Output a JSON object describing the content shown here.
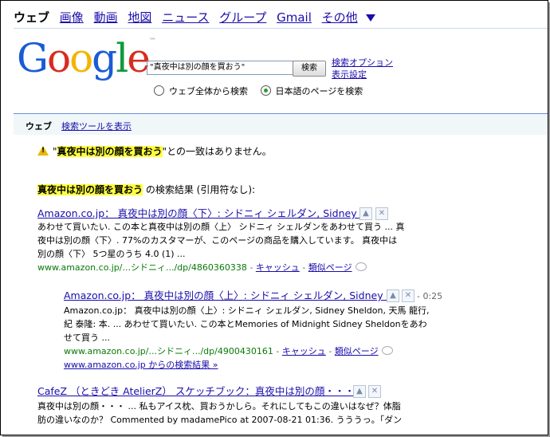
{
  "topnav": {
    "current": "ウェブ",
    "links": [
      "画像",
      "動画",
      "地図",
      "ニュース",
      "グループ",
      "Gmail",
      "その他"
    ]
  },
  "logo": {
    "text": "Google",
    "tm": "™"
  },
  "search": {
    "query": "\"真夜中は別の顔を買おう\"",
    "button": "検索",
    "advanced": "検索オプション",
    "prefs": "表示設定",
    "radio_all": "ウェブ全体から検索",
    "radio_jp": "日本語のページを検索"
  },
  "bar": {
    "web": "ウェブ",
    "tools": "検索ツールを表示"
  },
  "notice": {
    "quote_open": "\"",
    "query": "真夜中は別の顔を買おう",
    "quote_close": "\"",
    "rest": "との一致はありません。"
  },
  "results_for": {
    "query": "真夜中は別の顔を買おう",
    "rest": " の検索結果 (引用符なし):"
  },
  "results": [
    {
      "title": "Amazon.co.jp： 真夜中は別の顔〈下〉: シドニィ シェルダン, Sidney ...",
      "snippet": [
        "あわせて買いたい. この本と真夜中は別の顔〈上〉 シドニィ シェルダンをあわせて買う ... 真",
        "夜中は別の顔〈下〉. 77%のカスタマーが、このページの商品を購入しています。 真夜中は",
        "別の顔〈下〉 5つ星のうち 4.0 (1) ..."
      ],
      "url": "www.amazon.co.jp/...シドニィ.../dp/4860360338",
      "cache": "キャッシュ",
      "similar": "類似ページ"
    },
    {
      "title": "Amazon.co.jp： 真夜中は別の顔〈上〉: シドニィ シェルダン, Sidney ...",
      "time": "- 0:25",
      "snippet": [
        "Amazon.co.jp： 真夜中は別の顔〈上〉: シドニィ シェルダン, Sidney Sheldon, 天馬 龍行,",
        "紀 泰隆: 本. ... あわせて買いたい. この本とMemories of Midnight Sidney Sheldonをあわ",
        "せて買う ..."
      ],
      "url": "www.amazon.co.jp/...シドニィ.../dp/4900430161",
      "cache": "キャッシュ",
      "similar": "類似ページ",
      "more": "www.amazon.co.jp からの検索結果 »"
    },
    {
      "title": "CafeZ （ときどき AtelierZ） スケッチブック：真夜中は別の顔・・・",
      "snippet": [
        "真夜中は別の顔・・・ ... 私もアイス枕、買おうかしら。それにしてもこの違いはなぜ？体脂",
        "肪の違いなのか？ Commented by madamePico at 2007-08-21 01:36. うううっ。「ダン"
      ]
    }
  ]
}
